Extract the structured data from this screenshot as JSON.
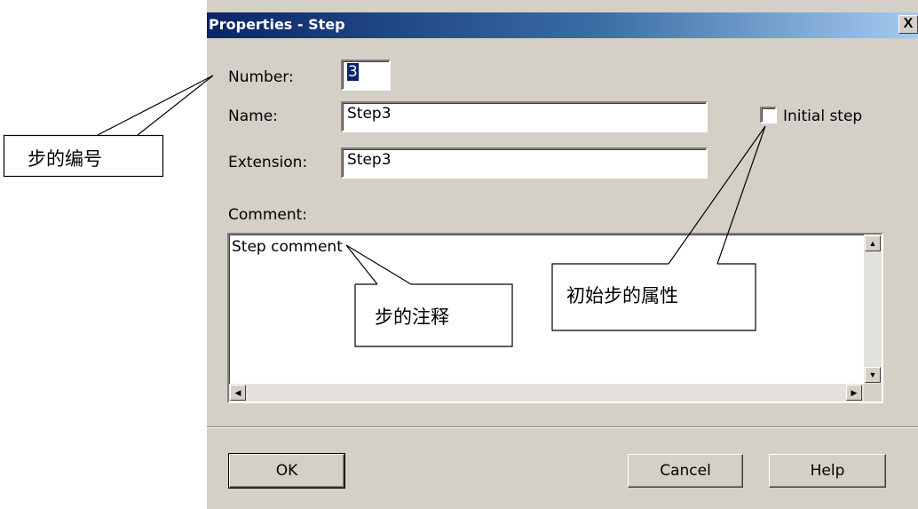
{
  "dialog": {
    "title": "Properties - Step",
    "close_label": "X",
    "number": {
      "label": "Number:",
      "value": "3"
    },
    "name": {
      "label": "Name:",
      "value": "Step3"
    },
    "extension": {
      "label": "Extension:",
      "value": "Step3"
    },
    "initial_step": {
      "label": "Initial step",
      "checked": false
    },
    "comment": {
      "label": "Comment:",
      "value": "Step comment"
    },
    "buttons": {
      "ok": "OK",
      "cancel": "Cancel",
      "help": "Help"
    }
  },
  "annotations": {
    "step_number": "步的编号",
    "step_comment": "步的注释",
    "initial_step_property": "初始步的属性"
  }
}
